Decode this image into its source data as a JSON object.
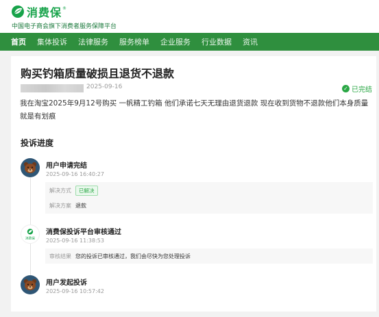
{
  "brand": {
    "name": "消费保",
    "slogan": "中国电子商会旗下消费者服务保障平台",
    "green": "#17a34a"
  },
  "nav": {
    "items": [
      "首页",
      "集体投诉",
      "法律服务",
      "服务榜单",
      "企业服务",
      "行业数据",
      "资讯"
    ],
    "active_index": 0,
    "bg": "#2f8f3e"
  },
  "complaint": {
    "title": "购买钓箱质量破损且退货不退款",
    "date": "2025-09-16",
    "status": "已完结",
    "description": "我在淘宝2025年9月12号购买 一帆精工钓箱 他们承诺七天无理由退货退款 现在收到货物不退款他们本身质量就是有划痕"
  },
  "progress": {
    "heading": "投诉进度",
    "steps": [
      {
        "title": "用户申请完结",
        "time": "2025-09-16 16:40:27",
        "avatar": "bear-avatar-icon",
        "details": [
          {
            "label": "解决方式",
            "value": "已解决",
            "style": "badge"
          },
          {
            "label": "解决方案",
            "value": "退款",
            "style": "text"
          }
        ]
      },
      {
        "title": "消费保投诉平台审核通过",
        "time": "2025-09-16 11:38:53",
        "avatar": "xiaofeibao-logo-icon",
        "avatar_text": "消费保",
        "details": [
          {
            "label": "审核结果",
            "value": "您的投诉已审核通过，我们会尽快为您处理投诉",
            "style": "text"
          }
        ]
      },
      {
        "title": "用户发起投诉",
        "time": "2025-09-16 10:57:42",
        "avatar": "bear-avatar-icon",
        "details": []
      }
    ]
  }
}
